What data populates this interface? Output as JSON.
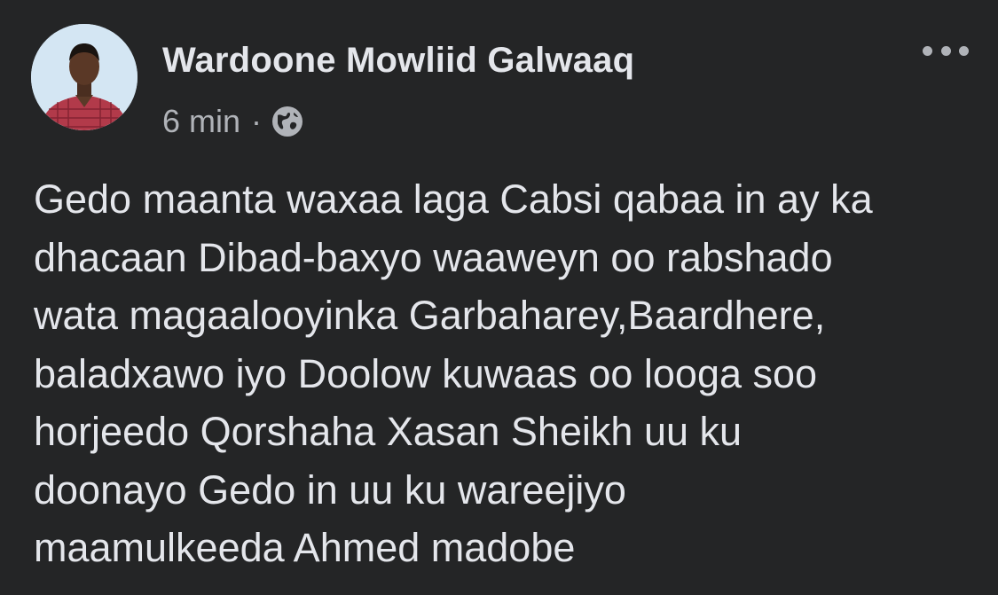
{
  "post": {
    "author": {
      "name": "Wardoone Mowliid Galwaaq",
      "avatar_icon": "profile-photo"
    },
    "meta": {
      "time": "6 min",
      "separator": "·",
      "audience_icon": "globe-icon"
    },
    "more_icon": "more-options-icon",
    "text": "Gedo maanta waxaa laga Cabsi qabaa in ay ka\ndhacaan Dibad-baxyo waaweyn oo rabshado\nwata magaalooyinka Garbaharey,Baardhere,\nbaladxawo iyo Doolow kuwaas oo looga soo\nhorjeedo Qorshaha Xasan Sheikh uu ku\ndoonayo Gedo in uu ku wareejiyo\nmaamulkeeda Ahmed madobe"
  },
  "colors": {
    "background": "#242526",
    "primary_text": "#e4e6eb",
    "secondary_text": "#b0b3b8"
  }
}
